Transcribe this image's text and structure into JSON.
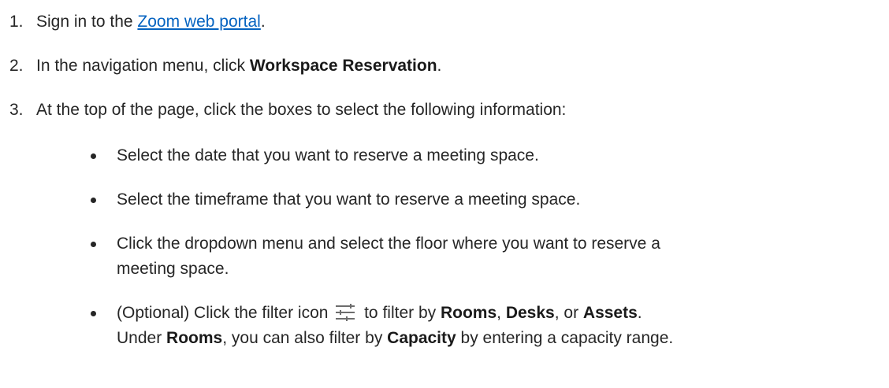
{
  "steps": [
    {
      "num": "1.",
      "pre": "Sign in to the ",
      "link": "Zoom web portal",
      "post": "."
    },
    {
      "num": "2.",
      "pre": "In the navigation menu, click ",
      "bold": "Workspace Reservation",
      "post": "."
    },
    {
      "num": "3.",
      "text": "At the top of the page, click the boxes to select the following information:"
    }
  ],
  "bullets": {
    "b1": "Select the date that you want to reserve a meeting space.",
    "b2": "Select the timeframe that you want to reserve a meeting space.",
    "b3_line1": "Click the dropdown menu and select the floor where you want to reserve a",
    "b3_line2": "meeting space.",
    "b4": {
      "pre": "(Optional) Click the filter icon ",
      "mid1": " to filter by ",
      "rooms": "Rooms",
      "comma1": ", ",
      "desks": "Desks",
      "or": ", or ",
      "assets": "Assets",
      "end": ".",
      "line2_pre": "Under ",
      "line2_rooms": "Rooms",
      "line2_mid": ", you can also filter by ",
      "capacity": "Capacity",
      "line2_end": " by entering a capacity range."
    }
  },
  "icons": {
    "filter": "filter-sliders-icon"
  },
  "colors": {
    "link": "#0563c1",
    "text": "#262626"
  }
}
